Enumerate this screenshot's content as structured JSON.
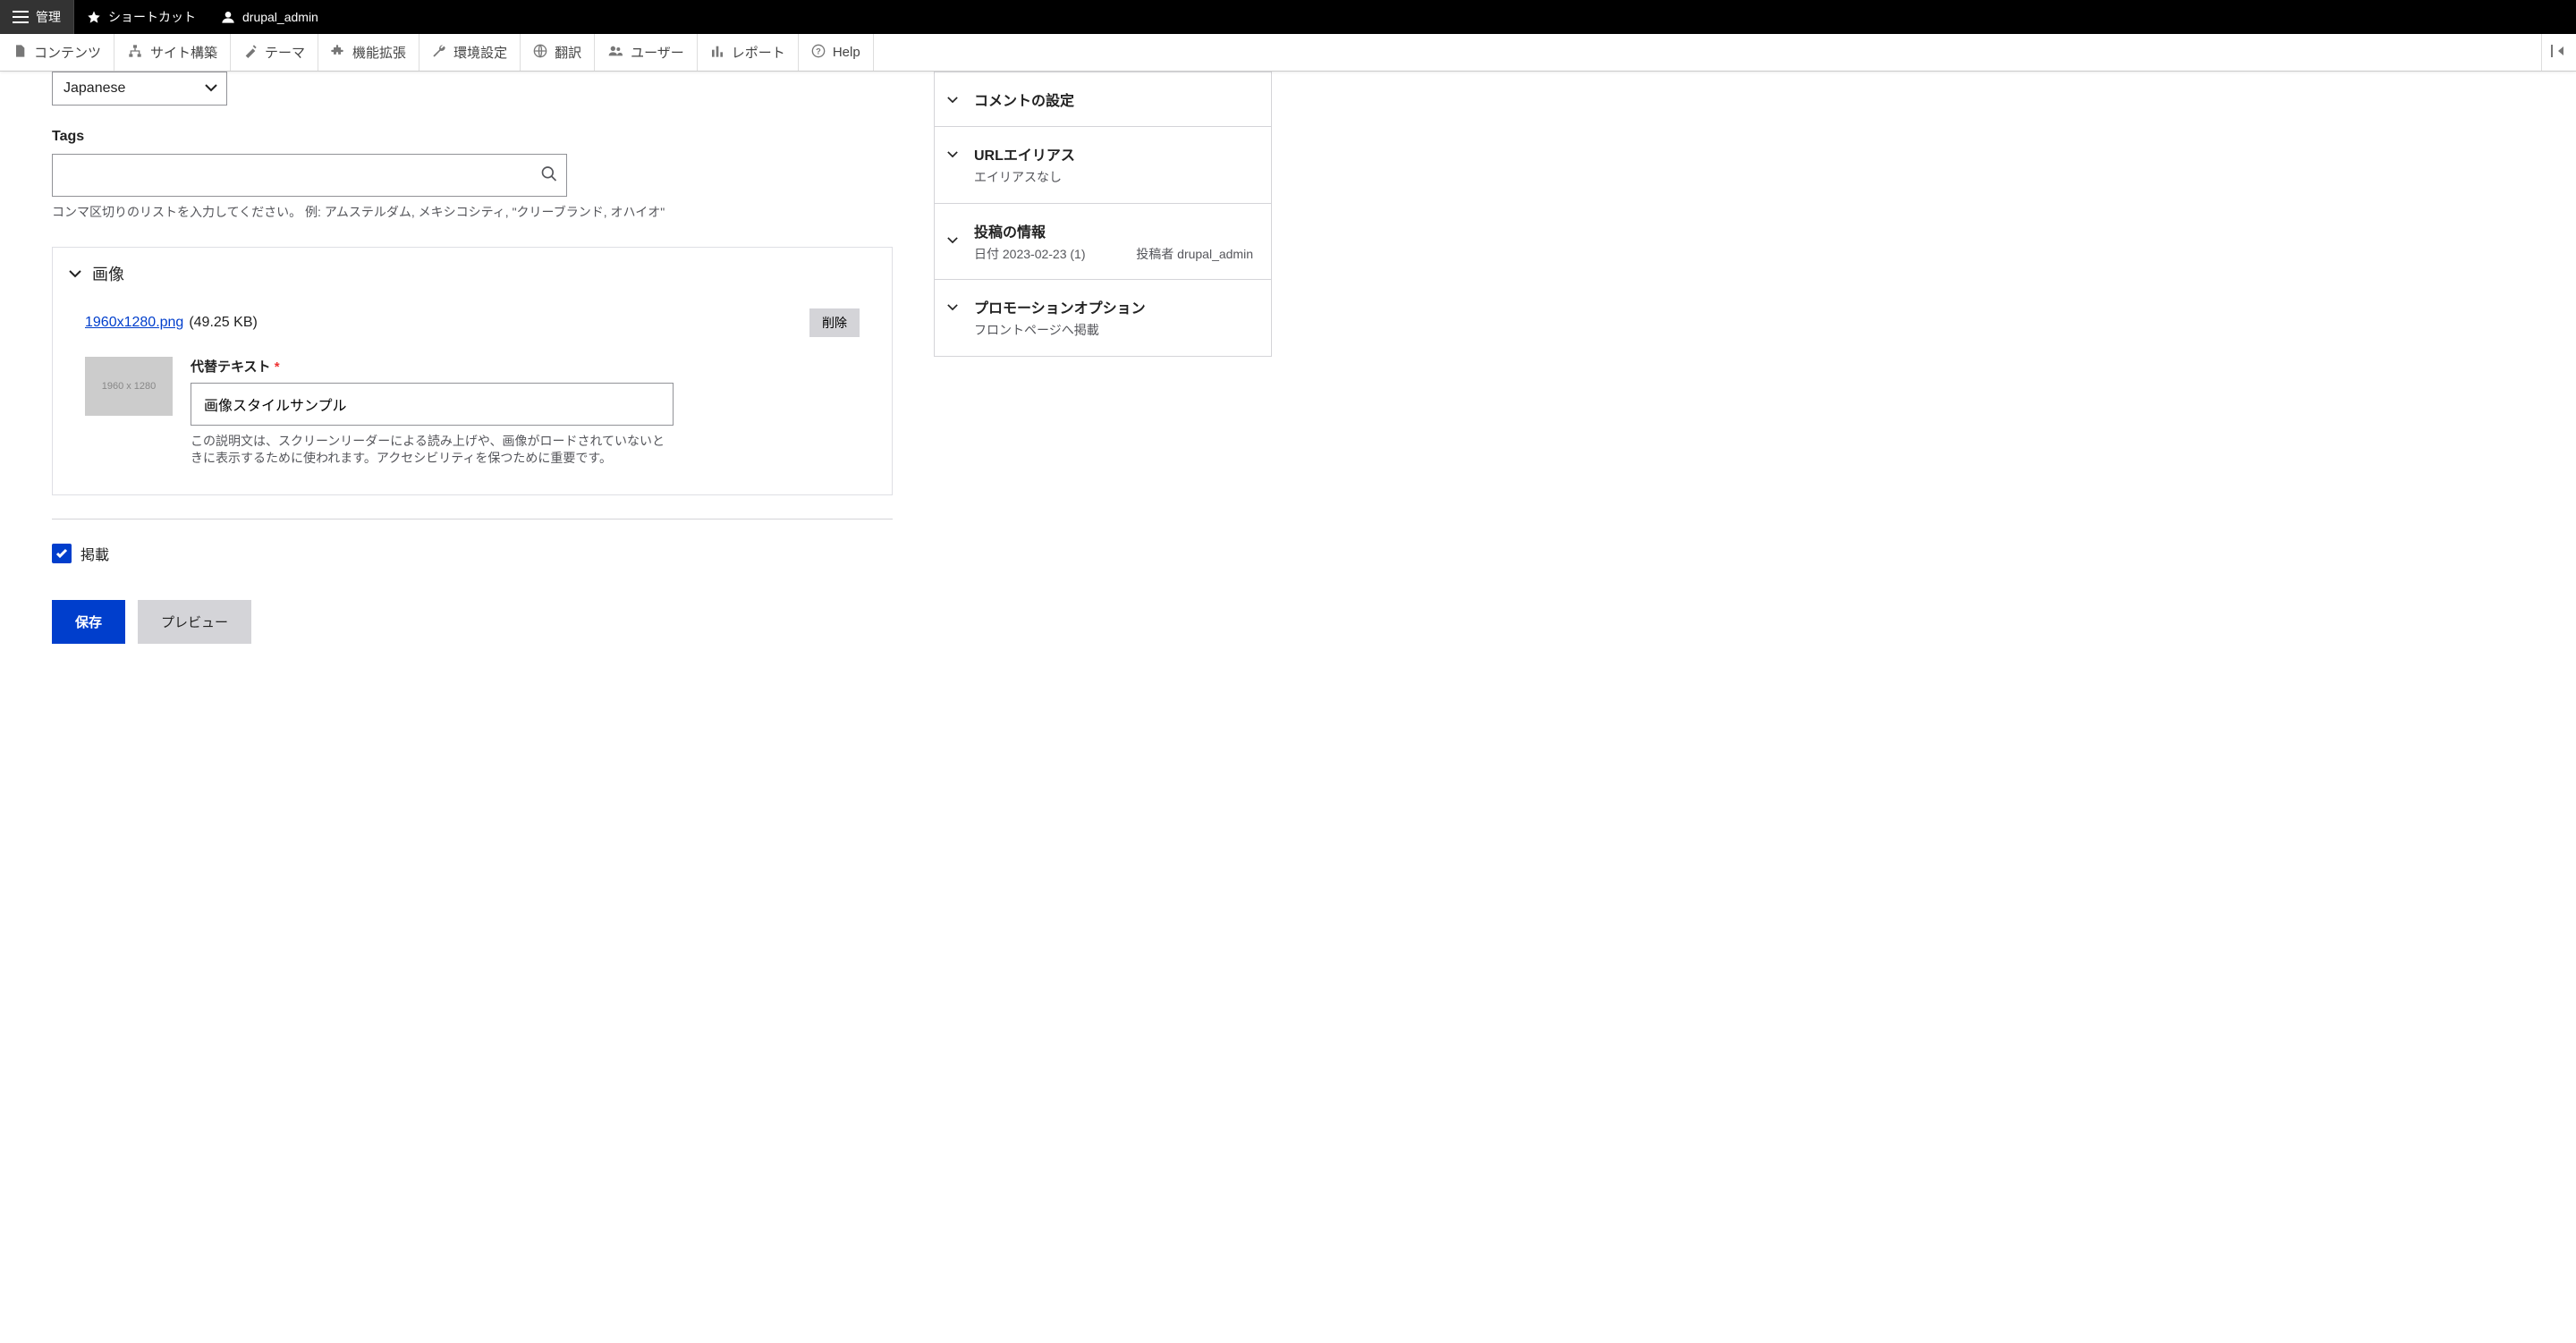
{
  "toolbar": {
    "manage": "管理",
    "shortcuts": "ショートカット",
    "user": "drupal_admin"
  },
  "admin_menu": {
    "content": "コンテンツ",
    "structure": "サイト構築",
    "appearance": "テーマ",
    "extend": "機能拡張",
    "config": "環境設定",
    "translate": "翻訳",
    "people": "ユーザー",
    "reports": "レポート",
    "help": "Help"
  },
  "form": {
    "language_value": "Japanese",
    "tags_label": "Tags",
    "tags_value": "",
    "tags_help": "コンマ区切りのリストを入力してください。 例: アムステルダム, メキシコシティ, \"クリーブランド, オハイオ\"",
    "image_section": "画像",
    "file_name": "1960x1280.png",
    "file_size": "(49.25 KB)",
    "delete": "削除",
    "thumb_label": "1960 x 1280",
    "alt_label": "代替テキスト",
    "alt_value": "画像スタイルサンプル",
    "alt_help": "この説明文は、スクリーンリーダーによる読み上げや、画像がロードされていないときに表示するために使われます。アクセシビリティを保つために重要です。",
    "published": "掲載",
    "save": "保存",
    "preview": "プレビュー"
  },
  "sidebar": {
    "comments": {
      "title": "コメントの設定"
    },
    "url_alias": {
      "title": "URLエイリアス",
      "sub": "エイリアスなし"
    },
    "author_info": {
      "title": "投稿の情報",
      "date_label": "日付",
      "date": "2023-02-23 (1)",
      "by_label": "投稿者",
      "by": "drupal_admin"
    },
    "promo": {
      "title": "プロモーションオプション",
      "sub": "フロントページへ掲載"
    }
  }
}
